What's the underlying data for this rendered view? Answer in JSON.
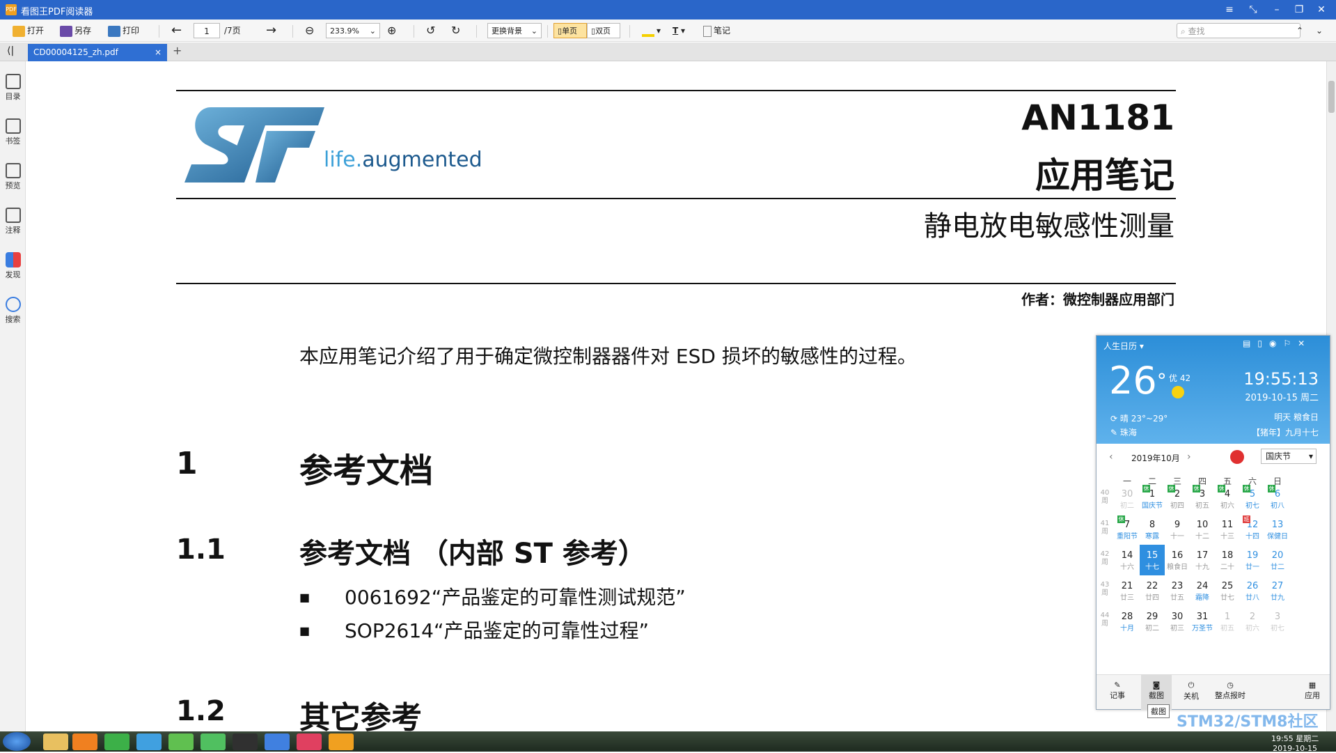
{
  "app": {
    "title": "看图王PDF阅读器",
    "window_controls": [
      "menu-icon",
      "fullscreen-icon",
      "minimize-icon",
      "restore-icon",
      "close-icon"
    ]
  },
  "toolbar": {
    "open": "打开",
    "save_as": "另存",
    "print": "打印",
    "page_current": "1",
    "page_total": "/7页",
    "zoom": "233.9%",
    "background": "更换背景",
    "single_page": "单页",
    "double_page": "双页",
    "notes": "笔记",
    "search_placeholder": "查找"
  },
  "tabs": [
    {
      "label": "CD00004125_zh.pdf"
    }
  ],
  "sidebar": {
    "items": [
      {
        "label": "目录",
        "icon": "list-icon"
      },
      {
        "label": "书签",
        "icon": "bookmark-icon"
      },
      {
        "label": "预览",
        "icon": "preview-icon"
      },
      {
        "label": "注释",
        "icon": "note-icon"
      },
      {
        "label": "发现",
        "icon": "apps-icon"
      },
      {
        "label": "搜索",
        "icon": "search-icon"
      }
    ]
  },
  "document": {
    "logo_tagline_1": "life.",
    "logo_tagline_2": "augmented",
    "doc_id": "AN1181",
    "doc_type": "应用笔记",
    "subtitle": "静电放电敏感性测量",
    "author": "作者：微控制器应用部门",
    "intro": "本应用笔记介绍了用于确定微控制器器件对 ESD 损坏的敏感性的过程。",
    "sections": [
      {
        "num": "1",
        "title": "参考文档"
      },
      {
        "num": "1.1",
        "title": "参考文档 （内部 ST 参考）"
      },
      {
        "num": "1.2",
        "title": "其它参考"
      }
    ],
    "bullets": [
      "0061692“产品鉴定的可靠性测试规范”",
      "SOP2614“产品鉴定的可靠性过程”"
    ]
  },
  "calendar": {
    "app_name": "人生日历",
    "temp": "26",
    "temp_unit": "°",
    "aqi": "优 42",
    "time": "19:55:13",
    "date": "2019-10-15 周二",
    "weather": "晴 23°~29°",
    "city": "珠海",
    "tomorrow": "明天 粮食日",
    "lunar": "【猪年】九月十七",
    "month": "2019年10月",
    "festival": "国庆节",
    "weekdays": [
      "一",
      "二",
      "三",
      "四",
      "五",
      "六",
      "日"
    ],
    "week_nums": [
      "40",
      "41",
      "42",
      "43",
      "44"
    ],
    "week_suffix": "周",
    "rows": [
      [
        [
          "30",
          "初二"
        ],
        [
          "1",
          "国庆节"
        ],
        [
          "2",
          "初四"
        ],
        [
          "3",
          "初五"
        ],
        [
          "4",
          "初六"
        ],
        [
          "5",
          "初七"
        ],
        [
          "6",
          "初八"
        ]
      ],
      [
        [
          "7",
          "重阳节"
        ],
        [
          "8",
          "寒露"
        ],
        [
          "9",
          "十一"
        ],
        [
          "10",
          "十二"
        ],
        [
          "11",
          "十三"
        ],
        [
          "12",
          "十四"
        ],
        [
          "13",
          "保健日"
        ]
      ],
      [
        [
          "14",
          "十六"
        ],
        [
          "15",
          "十七"
        ],
        [
          "16",
          "粮食日"
        ],
        [
          "17",
          "十九"
        ],
        [
          "18",
          "二十"
        ],
        [
          "19",
          "廿一"
        ],
        [
          "20",
          "廿二"
        ]
      ],
      [
        [
          "21",
          "廿三"
        ],
        [
          "22",
          "廿四"
        ],
        [
          "23",
          "廿五"
        ],
        [
          "24",
          "霜降"
        ],
        [
          "25",
          "廿七"
        ],
        [
          "26",
          "廿八"
        ],
        [
          "27",
          "廿九"
        ]
      ],
      [
        [
          "28",
          "十月"
        ],
        [
          "29",
          "初二"
        ],
        [
          "30",
          "初三"
        ],
        [
          "31",
          "万圣节"
        ],
        [
          "1",
          "初五"
        ],
        [
          "2",
          "初六"
        ],
        [
          "3",
          "初七"
        ]
      ]
    ],
    "rest_badge": "休",
    "work_badge": "班",
    "footer": [
      "记事",
      "截图",
      "关机",
      "整点报时",
      "应用"
    ],
    "tooltip": "截图"
  },
  "taskbar": {
    "clock_time": "19:55 星期二",
    "clock_date": "2019-10-15",
    "watermark": "STM32/STM8社区"
  }
}
